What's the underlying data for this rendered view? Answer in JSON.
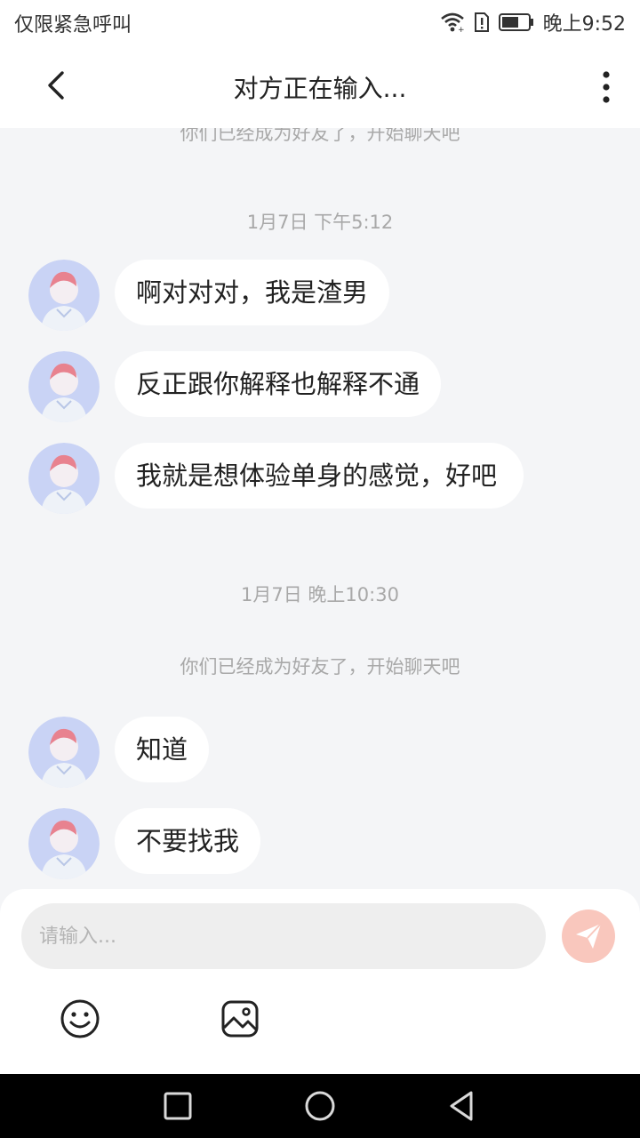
{
  "status_bar": {
    "carrier": "仅限紧急呼叫",
    "time": "晚上9:52",
    "icons": [
      "wifi-icon",
      "sim-alert-icon",
      "battery-icon"
    ]
  },
  "header": {
    "title": "对方正在输入...",
    "back_icon": "chevron-left-icon",
    "more_icon": "more-vertical-icon"
  },
  "chat": {
    "top_system_text": "你们已经成为好友了，开始聊天吧",
    "groups": [
      {
        "timestamp": "1月7日 下午5:12",
        "messages": [
          "啊对对对，我是渣男",
          "反正跟你解释也解释不通",
          "我就是想体验单身的感觉，好吧"
        ]
      },
      {
        "timestamp": "1月7日 晚上10:30",
        "system_text": "你们已经成为好友了，开始聊天吧",
        "messages": [
          "知道",
          "不要找我"
        ]
      }
    ]
  },
  "composer": {
    "placeholder": "请输入...",
    "send_icon": "send-icon",
    "emoji_icon": "emoji-icon",
    "image_icon": "image-icon"
  },
  "colors": {
    "background": "#f4f5f7",
    "bubble": "#ffffff",
    "send_button": "#f9c7bd",
    "system_text": "#a8a8a8"
  },
  "nav_bar": {
    "icons": [
      "recent-apps-icon",
      "home-icon",
      "back-icon"
    ]
  }
}
